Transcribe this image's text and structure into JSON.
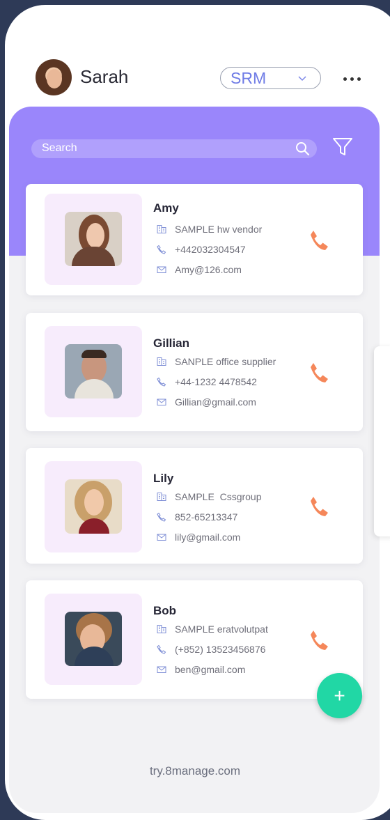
{
  "header": {
    "username": "Sarah",
    "module_select": "SRM",
    "more_icon": "more-horizontal-icon"
  },
  "search": {
    "placeholder": "Search",
    "icon": "search-icon",
    "filter_icon": "filter-icon"
  },
  "contacts": [
    {
      "name": "Amy",
      "company": "SAMPLE hw vendor",
      "phone": "+442032304547",
      "email": "Amy@126.com"
    },
    {
      "name": "Gillian",
      "company": "SANPLE office supplier",
      "phone": "+44-1232 4478542",
      "email": "Gillian@gmail.com"
    },
    {
      "name": "Lily",
      "company": "SAMPLE  Cssgroup",
      "phone": "852-65213347",
      "email": "lily@gmail.com"
    },
    {
      "name": "Bob",
      "company": "SAMPLE eratvolutpat",
      "phone": "(+852) 13523456876",
      "email": "ben@gmail.com"
    }
  ],
  "fab_label": "+",
  "footer": "try.8manage.com",
  "colors": {
    "accent_purple": "#9a86fb",
    "call_orange": "#f5875a",
    "fab_green": "#21d7a5",
    "select_text": "#6f7ce6"
  }
}
